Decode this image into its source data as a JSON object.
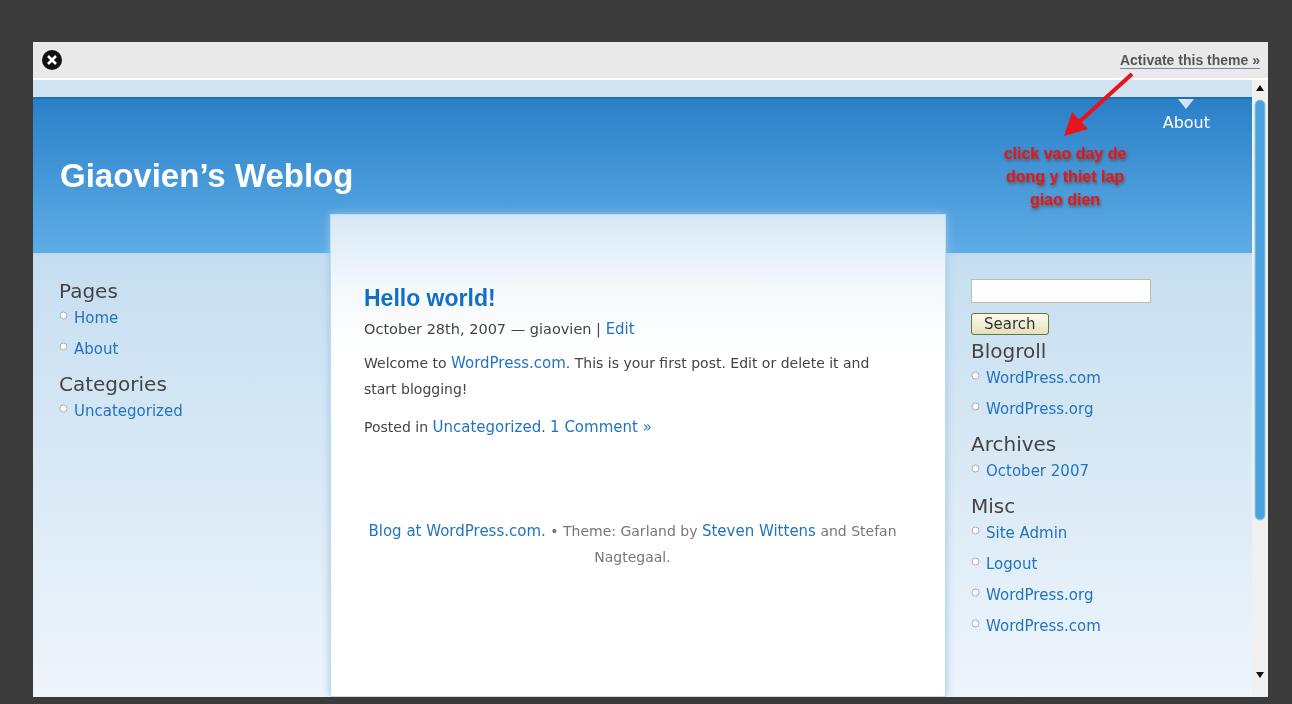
{
  "top_bar": {
    "activate_link": "Activate this theme »"
  },
  "header": {
    "site_title": "Giaovien’s Weblog",
    "nav": [
      {
        "label": "About",
        "selected": true
      }
    ]
  },
  "annotation": {
    "lines": [
      "click vao day de",
      "dong y thiet lap",
      "giao dien"
    ]
  },
  "left_sidebar": {
    "sections": [
      {
        "heading": "Pages",
        "links": [
          "Home",
          "About"
        ]
      },
      {
        "heading": "Categories",
        "links": [
          "Uncategorized"
        ]
      }
    ]
  },
  "post": {
    "title": "Hello world!",
    "meta": "October 28th, 2007 — giaovien | ",
    "edit_link": "Edit",
    "body": [
      {
        "kind": "text",
        "text": "Welcome to "
      },
      {
        "kind": "link",
        "text": "WordPress.com"
      },
      {
        "kind": "text",
        "text": ". This is your first post. Edit or delete it and start blogging!"
      }
    ],
    "posted": [
      {
        "kind": "text",
        "text": "Posted in "
      },
      {
        "kind": "link",
        "text": "Uncategorized"
      },
      {
        "kind": "text",
        "text": ". "
      },
      {
        "kind": "link",
        "text": "1 Comment »"
      }
    ],
    "footer": [
      {
        "kind": "link",
        "text": "Blog at WordPress.com."
      },
      {
        "kind": "text",
        "text": " • Theme: Garland by "
      },
      {
        "kind": "link",
        "text": "Steven Wittens"
      },
      {
        "kind": "text",
        "text": " and Stefan Nagtegaal."
      }
    ]
  },
  "right_sidebar": {
    "search_button": "Search",
    "sections": [
      {
        "heading": "Blogroll",
        "links": [
          "WordPress.com",
          "WordPress.org"
        ]
      },
      {
        "heading": "Archives",
        "links": [
          "October 2007"
        ]
      },
      {
        "heading": "Misc",
        "links": [
          "Site Admin",
          "Logout",
          "WordPress.org",
          "WordPress.com"
        ]
      }
    ]
  }
}
